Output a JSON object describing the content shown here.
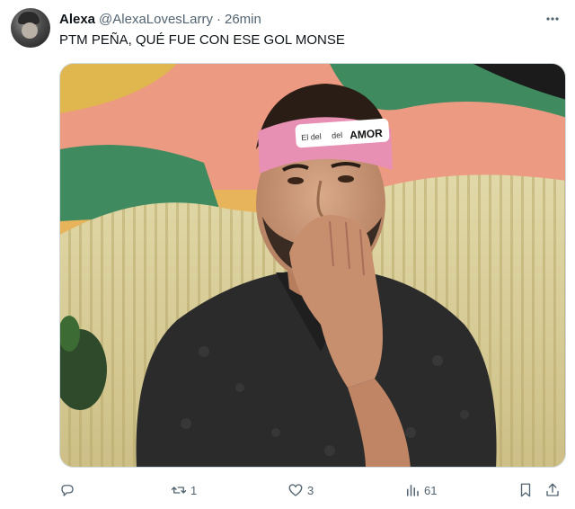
{
  "tweet": {
    "author_name": "Alexa",
    "author_handle": "@AlexaLovesLarry",
    "separator": "·",
    "time": "26min",
    "text": "PTM PEÑA, QUÉ FUE CON ESE GOL MONSE",
    "media_headband_text_1": "El del",
    "media_headband_text_2": "del",
    "media_headband_text_3": "AMOR"
  },
  "actions": {
    "reply_count": "",
    "retweet_count": "1",
    "like_count": "3",
    "views_count": "61"
  },
  "icons": {
    "more": "more-horizontal-icon",
    "reply": "reply-icon",
    "retweet": "retweet-icon",
    "like": "heart-icon",
    "views": "bar-chart-icon",
    "bookmark": "bookmark-icon",
    "share": "share-icon"
  },
  "colors": {
    "text": "#0f1419",
    "secondary": "#536471",
    "headband": "#e88fb4"
  }
}
